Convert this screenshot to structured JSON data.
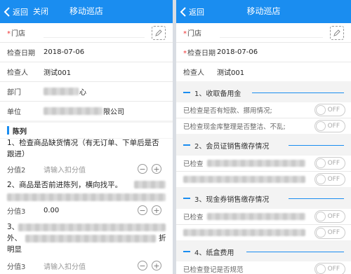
{
  "left": {
    "back_label": "返回",
    "close_label": "关闭",
    "title": "移动巡店",
    "store_label": "门店",
    "date_label": "检查日期",
    "date_value": "2018-07-06",
    "inspector_label": "检查人",
    "inspector_value": "测试001",
    "dept_label": "部门",
    "dept_value_tail": "心",
    "unit_label": "单位",
    "unit_value_tail": "限公司",
    "section_title": "陈列",
    "q1_text": "1、检查商品缺货情况（有无订单、下单后是否跟进）",
    "score2_label": "分值2",
    "score2_placeholder": "请输入扣分值",
    "q2_text": "2、商品是否前进陈列，横向找平。",
    "score3_label": "分值3",
    "score3_value": "0.00",
    "q3_prefix": "3、",
    "q3_line2_prefix": "外、",
    "q3_line2_suffix": "折",
    "q3_line3": "明显",
    "score3b_label": "分值3",
    "score3b_placeholder": "请输入扣分值"
  },
  "right": {
    "back_label": "返回",
    "title": "移动巡店",
    "store_label": "门店",
    "date_label": "检查日期",
    "date_value": "2018-07-06",
    "inspector_label": "检查人",
    "inspector_value": "测试001",
    "groups": [
      {
        "title": "1、收取备用金"
      },
      {
        "title": "2、会员证销售缴存情况"
      },
      {
        "title": "3、现金券销售缴存情况"
      },
      {
        "title": "4、纸盒费用"
      }
    ],
    "g1_item1": "已检查是否有短款、挪用情况;",
    "g1_item2": "已检查现金库整理是否整洁、不乱;",
    "g2_item_prefix": "已检查",
    "g3_item_prefix": "已检查",
    "g4_item1": "已检查登记是否规范",
    "toggle_off": "OFF"
  },
  "colors": {
    "header": "#1a8df0",
    "accent": "#1a8df0",
    "required": "#e33"
  }
}
